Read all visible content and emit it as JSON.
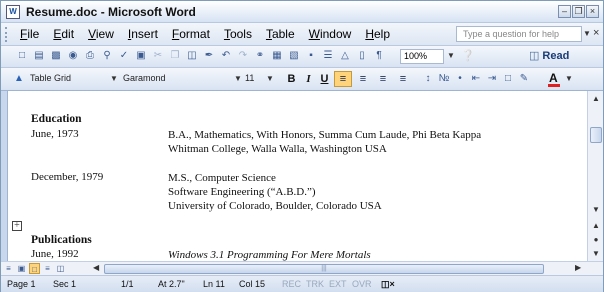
{
  "window": {
    "title": "Resume.doc - Microsoft Word",
    "app_icon": "W"
  },
  "menu": {
    "items": [
      "File",
      "Edit",
      "View",
      "Insert",
      "Format",
      "Tools",
      "Table",
      "Window",
      "Help"
    ],
    "help_placeholder": "Type a question for help"
  },
  "toolbar": {
    "zoom": "100%",
    "read_label": "Read"
  },
  "formatting": {
    "style": "Table Grid",
    "font": "Garamond",
    "size": "11",
    "bold": "B",
    "italic": "I",
    "underline": "U",
    "font_color_label": "A",
    "font_color": "#e02020"
  },
  "document": {
    "education_heading": "Education",
    "entries": [
      {
        "date": "June, 1973",
        "lines": [
          "B.A., Mathematics, With Honors, Summa Cum Laude, Phi Beta Kappa",
          "Whitman College, Walla Walla, Washington USA"
        ]
      },
      {
        "date": "December, 1979",
        "lines": [
          "M.S., Computer Science",
          "Software Engineering (“A.B.D.”)",
          "University of Colorado, Boulder, Colorado USA"
        ]
      }
    ],
    "publications_heading": "Publications",
    "publication": {
      "date": "June, 1992",
      "title": "Windows 3.1 Programming For Mere Mortals"
    }
  },
  "status": {
    "page": "Page 1",
    "section": "Sec 1",
    "pages": "1/1",
    "at": "At 2.7\"",
    "line": "Ln 11",
    "col": "Col 15",
    "rec": "REC",
    "trk": "TRK",
    "ext": "EXT",
    "ovr": "OVR"
  }
}
